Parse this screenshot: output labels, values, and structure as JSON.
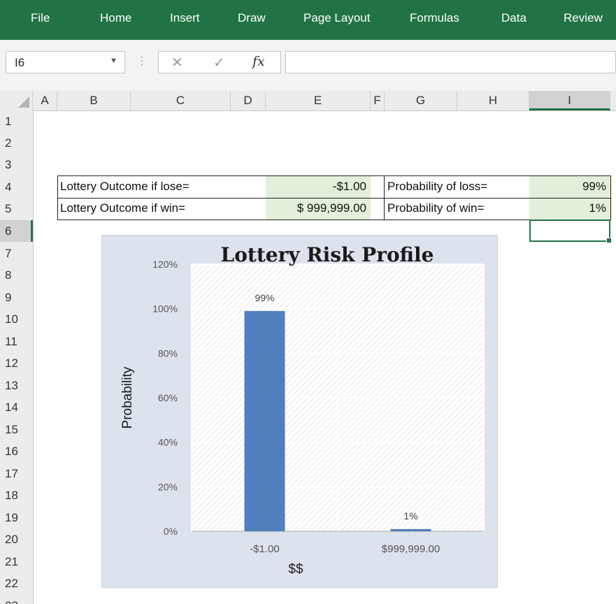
{
  "ribbon": {
    "tabs": [
      "File",
      "Home",
      "Insert",
      "Draw",
      "Page Layout",
      "Formulas",
      "Data",
      "Review"
    ]
  },
  "formula_bar": {
    "name_box": "I6",
    "cancel_icon": "cancel-icon",
    "enter_icon": "check-icon",
    "fx_label": "fx",
    "formula": ""
  },
  "grid": {
    "columns": [
      "A",
      "B",
      "C",
      "D",
      "E",
      "F",
      "G",
      "H",
      "I"
    ],
    "selected_column": "I",
    "rows": [
      "1",
      "2",
      "3",
      "4",
      "5",
      "6",
      "7",
      "8",
      "9",
      "10",
      "11",
      "12",
      "13",
      "14",
      "15",
      "16",
      "17",
      "18",
      "19",
      "20",
      "21",
      "22",
      "23"
    ],
    "selected_row": "6"
  },
  "table": {
    "lose_label": "Lottery Outcome if lose=",
    "lose_value": "-$1.00",
    "win_label": "Lottery Outcome if win=",
    "win_value": "$ 999,999.00",
    "loss_prob_label": "Probability of loss=",
    "loss_prob_value": "99%",
    "win_prob_label": "Probability of win=",
    "win_prob_value": "1%"
  },
  "colors": {
    "ribbon": "#217346",
    "input_fill": "#e2efda",
    "bar": "#4f7fbc",
    "chart_bg": "#dce3ec"
  },
  "chart_data": {
    "type": "bar",
    "title": "Lottery Risk Profile",
    "xlabel": "$$",
    "ylabel": "Probability",
    "categories": [
      "-$1.00",
      "$999,999.00"
    ],
    "values": [
      99,
      1
    ],
    "data_labels": [
      "99%",
      "1%"
    ],
    "ylim": [
      0,
      120
    ],
    "yticks": [
      "0%",
      "20%",
      "40%",
      "60%",
      "80%",
      "100%",
      "120%"
    ],
    "grid": true,
    "plot_pattern": "diagonal hatch"
  }
}
